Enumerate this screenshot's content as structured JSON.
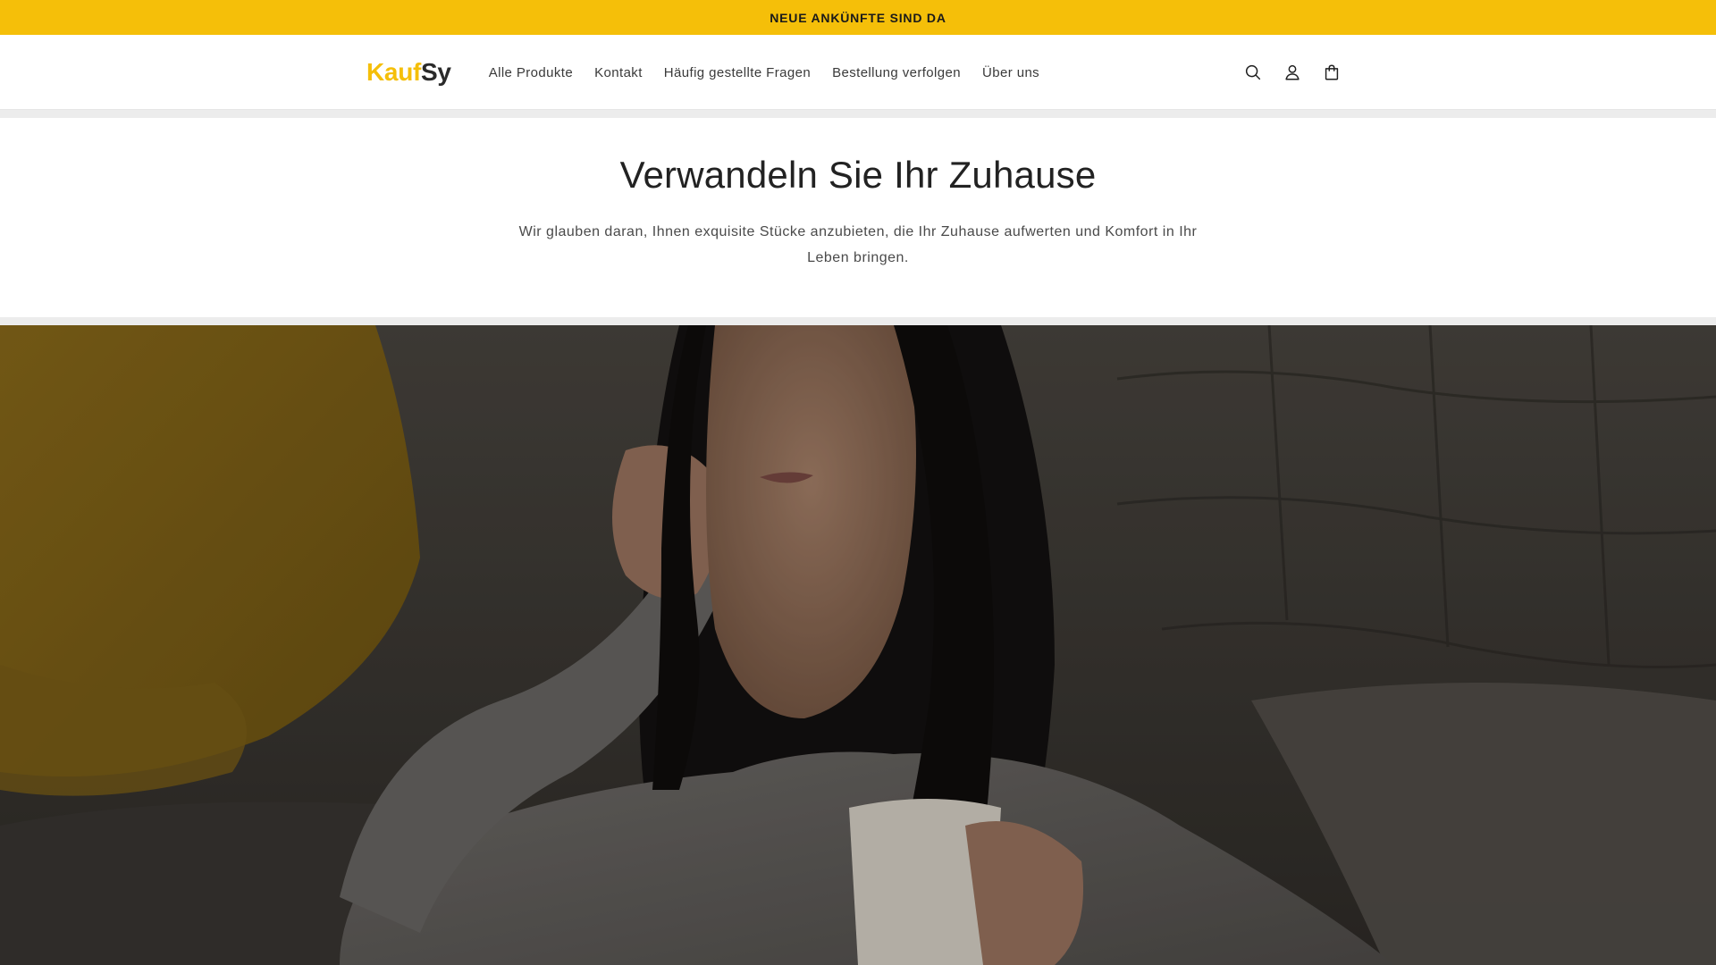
{
  "announcement": {
    "text": "NEUE ANKÜNFTE SIND DA"
  },
  "header": {
    "logo_part1": "Kauf",
    "logo_part2": "Sy",
    "nav": [
      {
        "label": "Alle Produkte"
      },
      {
        "label": "Kontakt"
      },
      {
        "label": "Häufig gestellte Fragen"
      },
      {
        "label": "Bestellung verfolgen"
      },
      {
        "label": "Über uns"
      }
    ],
    "icons": [
      "search-icon",
      "account-icon",
      "cart-icon"
    ]
  },
  "intro": {
    "title": "Verwandeln Sie Ihr Zuhause",
    "text": "Wir glauben daran, Ihnen exquisite Stücke anzubieten, die Ihr Zuhause aufwerten und Komfort in Ihr Leben bringen."
  },
  "colors": {
    "accent": "#f5bf09",
    "text_dark": "#222222",
    "divider": "#ececec"
  }
}
